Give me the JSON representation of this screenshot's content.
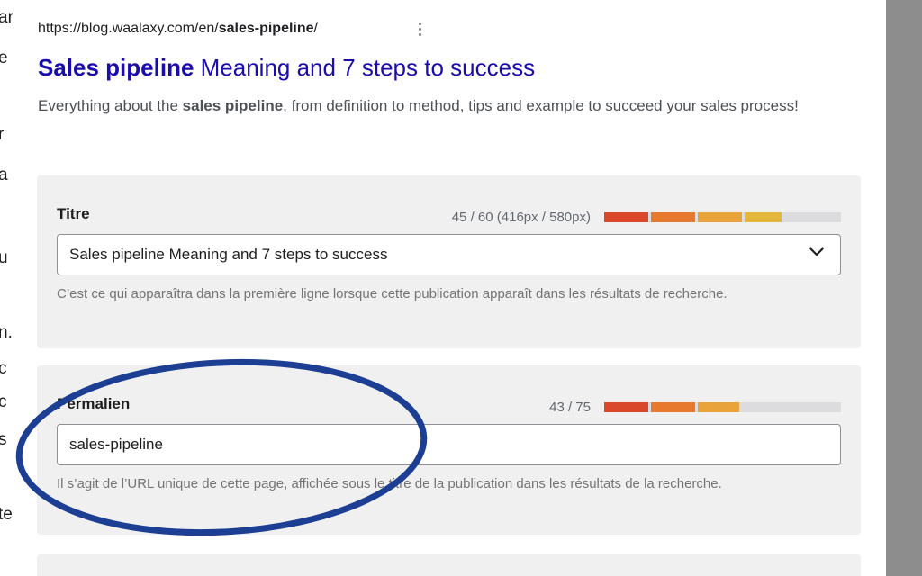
{
  "background_page": {
    "edge_fragments": [
      "ar",
      "e",
      "r",
      "a",
      "u",
      "n.",
      "c",
      "c",
      "s",
      "te"
    ]
  },
  "serp_preview": {
    "url_prefix": "https://blog.waalaxy.com/en/",
    "url_slug": "sales-pipeline",
    "url_suffix": "/",
    "title_bold": "Sales pipeline",
    "title_rest": " Meaning and 7 steps to success",
    "desc_before": "Everything about the ",
    "desc_bold": "sales pipeline",
    "desc_after": ", from definition to method, tips and example to succeed your sales process!",
    "menu_icon": "more-vertical-icon"
  },
  "title_field": {
    "label": "Titre",
    "counter": "45 / 60 (416px / 580px)",
    "value": "Sales pipeline Meaning and 7 steps to success",
    "help": "C’est ce qui apparaîtra dans la première ligne lorsque cette publication apparaît dans les résultats de recherche.",
    "progress": 0.75,
    "dropdown_icon": "chevron-down-icon"
  },
  "permalink_field": {
    "label": "Permalien",
    "counter": "43 / 75",
    "value": "sales-pipeline",
    "help": "Il s’agit de l’URL unique de cette page, affichée sous le titre de la publication dans les résultats de la recherche.",
    "progress": 0.57
  },
  "colors": {
    "link_blue": "#1a0dab",
    "annotation_blue": "#1c3f94",
    "meter_segments": [
      "#d9482b",
      "#e6792e",
      "#e8a33a",
      "#e3b73c",
      "#9ab83a"
    ]
  }
}
